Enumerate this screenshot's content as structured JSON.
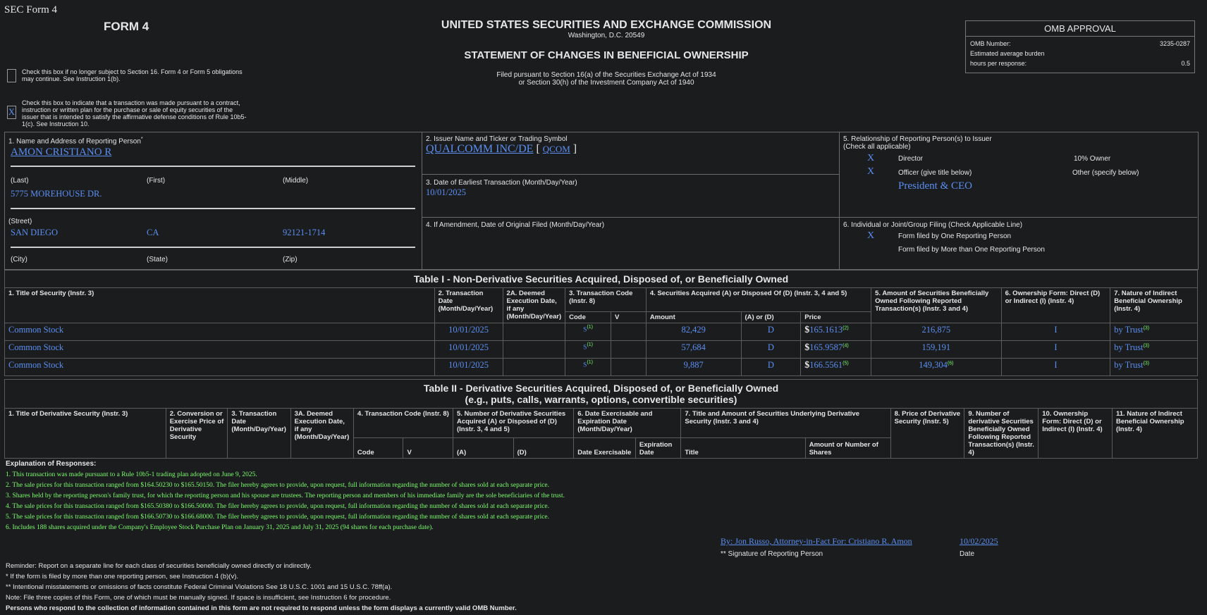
{
  "header": {
    "sec_form": "SEC Form 4",
    "form": "FORM 4",
    "agency": "UNITED STATES SECURITIES AND EXCHANGE COMMISSION",
    "city": "Washington, D.C. 20549",
    "statement": "STATEMENT OF CHANGES IN BENEFICIAL OWNERSHIP",
    "filed_line1": "Filed pursuant to Section 16(a) of the Securities Exchange Act of 1934",
    "filed_line2": "or Section 30(h) of the Investment Company Act of 1940",
    "check1": "Check this box if no longer subject to Section 16. Form 4 or Form 5 obligations may continue. See Instruction 1(b).",
    "check2": "Check this box to indicate that a transaction was made pursuant to a contract, instruction or written plan for the purchase or sale of equity securities of the issuer that is intended to satisfy the affirmative defense conditions of Rule 10b5-1(c). See Instruction 10.",
    "check2_mark": "X"
  },
  "omb": {
    "title": "OMB APPROVAL",
    "number_label": "OMB Number:",
    "number": "3235-0287",
    "burden_label": "Estimated average burden",
    "hours_label": "hours per response:",
    "hours": "0.5"
  },
  "box1": {
    "label": "1. Name and Address of Reporting Person",
    "star": "*",
    "name": "AMON CRISTIANO R",
    "last": "(Last)",
    "first": "(First)",
    "middle": "(Middle)",
    "street_value": "5775 MOREHOUSE DR.",
    "street": "(Street)",
    "city_value": "SAN DIEGO",
    "state_value": "CA",
    "zip_value": "92121-1714",
    "city": "(City)",
    "state": "(State)",
    "zip": "(Zip)"
  },
  "box2": {
    "label": "2. Issuer Name and Ticker or Trading Symbol",
    "issuer": "QUALCOMM INC/DE",
    "bracket_open": "[",
    "ticker": "QCOM",
    "bracket_close": "]"
  },
  "box3": {
    "label": "3. Date of Earliest Transaction (Month/Day/Year)",
    "value": "10/01/2025"
  },
  "box4": {
    "label": "4. If Amendment, Date of Original Filed (Month/Day/Year)"
  },
  "box5": {
    "label1": "5. Relationship of Reporting Person(s) to Issuer",
    "label2": "(Check all applicable)",
    "director_mark": "X",
    "director": "Director",
    "owner10": "10% Owner",
    "officer_mark": "X",
    "officer": "Officer (give title below)",
    "other": "Other (specify below)",
    "title": "President & CEO"
  },
  "box6": {
    "label": "6. Individual or Joint/Group Filing (Check Applicable Line)",
    "one_mark": "X",
    "one": "Form filed by One Reporting Person",
    "more": "Form filed by More than One Reporting Person"
  },
  "table1": {
    "title": "Table I - Non-Derivative Securities Acquired, Disposed of, or Beneficially Owned",
    "h1": "1. Title of Security (Instr. 3)",
    "h2": "2. Transaction Date (Month/Day/Year)",
    "h2a": "2A. Deemed Execution Date, if any (Month/Day/Year)",
    "h3": "3. Transaction Code (Instr. 8)",
    "h4": "4. Securities Acquired (A) or Disposed Of (D) (Instr. 3, 4 and 5)",
    "h5": "5. Amount of Securities Beneficially Owned Following Reported Transaction(s) (Instr. 3 and 4)",
    "h6": "6. Ownership Form: Direct (D) or Indirect (I) (Instr. 4)",
    "h7": "7. Nature of Indirect Beneficial Ownership (Instr. 4)",
    "sub_code": "Code",
    "sub_v": "V",
    "sub_amount": "Amount",
    "sub_ad": "(A) or (D)",
    "sub_price": "Price",
    "rows": [
      {
        "title": "Common Stock",
        "date": "10/01/2025",
        "code": "S",
        "code_fn": "(1)",
        "amount": "82,429",
        "ad": "D",
        "dollar": "$",
        "price": "165.1613",
        "price_fn": "(2)",
        "owned": "216,875",
        "owned_fn": "",
        "form": "I",
        "nature": "by Trust",
        "nature_fn": "(3)"
      },
      {
        "title": "Common Stock",
        "date": "10/01/2025",
        "code": "S",
        "code_fn": "(1)",
        "amount": "57,684",
        "ad": "D",
        "dollar": "$",
        "price": "165.9587",
        "price_fn": "(4)",
        "owned": "159,191",
        "owned_fn": "",
        "form": "I",
        "nature": "by Trust",
        "nature_fn": "(3)"
      },
      {
        "title": "Common Stock",
        "date": "10/01/2025",
        "code": "S",
        "code_fn": "(1)",
        "amount": "9,887",
        "ad": "D",
        "dollar": "$",
        "price": "166.5561",
        "price_fn": "(5)",
        "owned": "149,304",
        "owned_fn": "(6)",
        "form": "I",
        "nature": "by Trust",
        "nature_fn": "(3)"
      }
    ]
  },
  "table2": {
    "title1": "Table II - Derivative Securities Acquired, Disposed of, or Beneficially Owned",
    "title2": "(e.g., puts, calls, warrants, options, convertible securities)",
    "h1": "1. Title of Derivative Security (Instr. 3)",
    "h2": "2. Conversion or Exercise Price of Derivative Security",
    "h3": "3. Transaction Date (Month/Day/Year)",
    "h3a": "3A. Deemed Execution Date, if any (Month/Day/Year)",
    "h4": "4. Transaction Code (Instr. 8)",
    "h5": "5. Number of Derivative Securities Acquired (A) or Disposed of (D) (Instr. 3, 4 and 5)",
    "h6": "6. Date Exercisable and Expiration Date (Month/Day/Year)",
    "h7": "7. Title and Amount of Securities Underlying Derivative Security (Instr. 3 and 4)",
    "h8": "8. Price of Derivative Security (Instr. 5)",
    "h9": "9. Number of derivative Securities Beneficially Owned Following Reported Transaction(s) (Instr. 4)",
    "h10": "10. Ownership Form: Direct (D) or Indirect (I) (Instr. 4)",
    "h11": "11. Nature of Indirect Beneficial Ownership (Instr. 4)",
    "s_code": "Code",
    "s_v": "V",
    "s_a": "(A)",
    "s_d": "(D)",
    "s_de": "Date Exercisable",
    "s_ed": "Expiration Date",
    "s_title": "Title",
    "s_amount": "Amount or Number of Shares"
  },
  "explanation": {
    "title": "Explanation of Responses:",
    "items": [
      "1. This transaction was made pursuant to a Rule 10b5-1 trading plan adopted on June 9, 2025.",
      "2. The sale prices for this transaction ranged from $164.50230 to $165.50150. The filer hereby agrees to provide, upon request, full information regarding the number of shares sold at each separate price.",
      "3. Shares held by the reporting person's family trust, for which the reporting person and his spouse are trustees. The reporting person and members of his immediate family are the sole beneficiaries of the trust.",
      "4. The sale prices for this transaction ranged from $165.50380 to $166.50000. The filer hereby agrees to provide, upon request, full information regarding the number of shares sold at each separate price.",
      "5. The sale prices for this transaction ranged from $166.50730 to $166.68000. The filer hereby agrees to provide, upon request, full information regarding the number of shares sold at each separate price.",
      "6. Includes 188 shares acquired under the Company's Employee Stock Purchase Plan on January 31, 2025 and July 31, 2025 (94 shares for each purchase date)."
    ]
  },
  "signature": {
    "name": "By: Jon Russo, Attorney-in-Fact For: Cristiano R. Amon",
    "date": "10/02/2025",
    "sig_label": "** Signature of Reporting Person",
    "date_label": "Date"
  },
  "footer": {
    "l1": "Reminder: Report on a separate line for each class of securities beneficially owned directly or indirectly.",
    "l2": "* If the form is filed by more than one reporting person, see Instruction 4 (b)(v).",
    "l3": "** Intentional misstatements or omissions of facts constitute Federal Criminal Violations See 18 U.S.C. 1001 and 15 U.S.C. 78ff(a).",
    "l4": "Note: File three copies of this Form, one of which must be manually signed. If space is insufficient, see Instruction 6 for procedure.",
    "l5": "Persons who respond to the collection of information contained in this form are not required to respond unless the form displays a currently valid OMB Number."
  }
}
